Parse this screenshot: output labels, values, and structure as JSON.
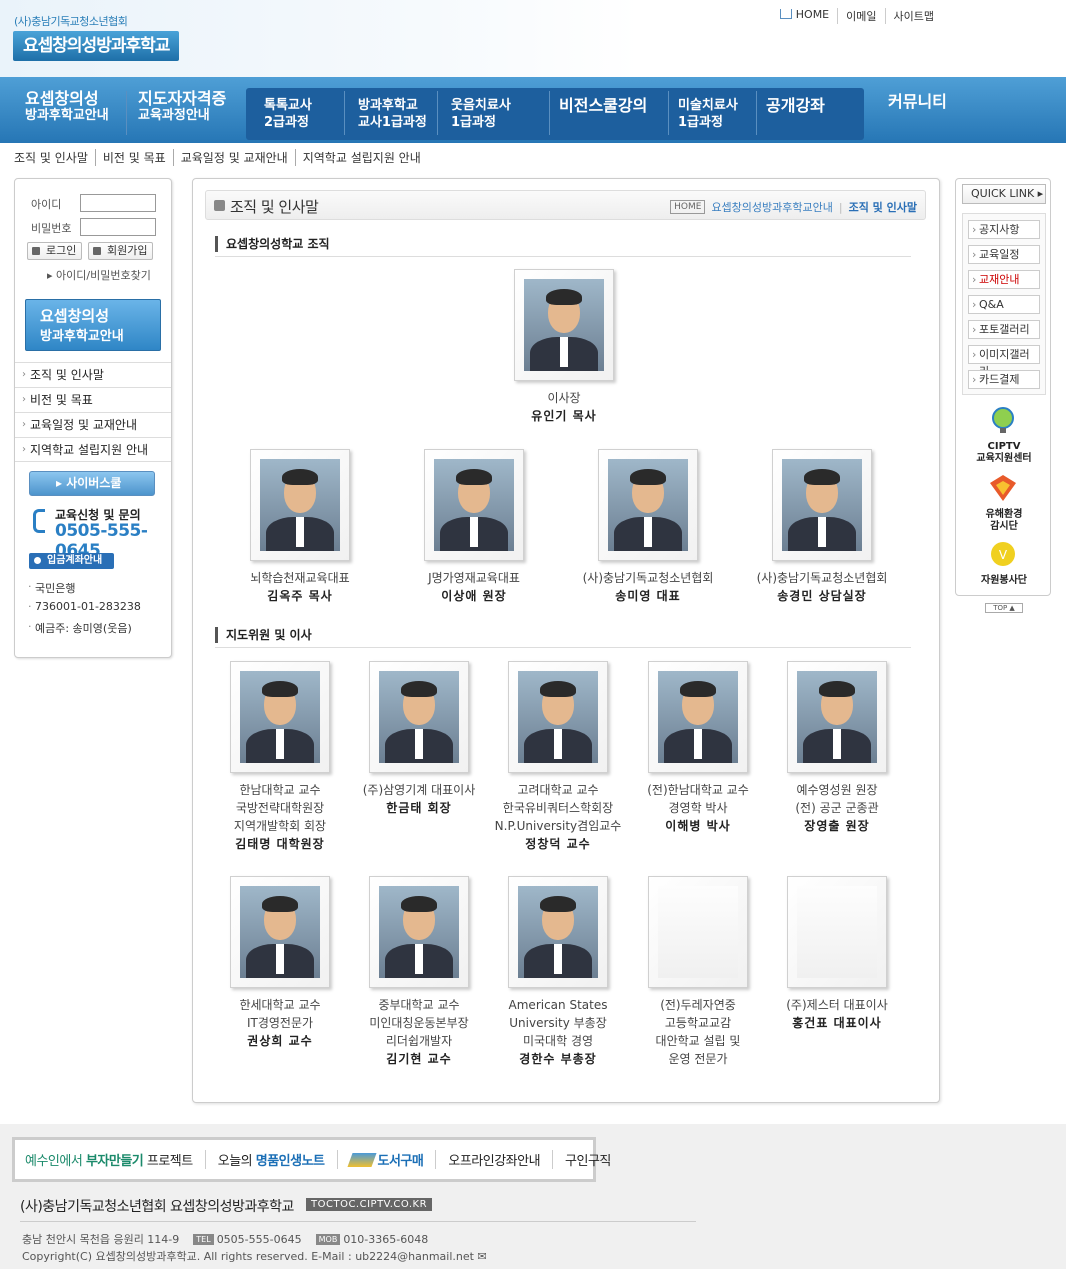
{
  "header": {
    "org_small": "(사)충남기독교청소년협회",
    "logo": "요셉창의성방과후학교",
    "links": [
      "HOME",
      "이메일",
      "사이트맵"
    ]
  },
  "nav": {
    "m1_title": "요셉창의성",
    "m1_sub": "방과후학교안내",
    "m2_title": "지도자자격증",
    "m2_sub": "교육과정안내",
    "s1_a": "톡톡교사",
    "s1_b": "2급과정",
    "s2_a": "방과후학교",
    "s2_b": "교사1급과정",
    "s3_a": "웃음치료사",
    "s3_b": "1급과정",
    "s4": "비전스쿨강의",
    "s5_a": "미술치료사",
    "s5_b": "1급과정",
    "s6": "공개강좌",
    "m3": "커뮤니티"
  },
  "crumbs": [
    "조직 및 인사말",
    "비전 및 목표",
    "교육일정 및 교재안내",
    "지역학교 설립지원 안내"
  ],
  "sidebar": {
    "id_label": "아이디",
    "pw_label": "비밀번호",
    "login": "로그인",
    "join": "회원가입",
    "find": "아이디/비밀번호찾기",
    "banner_title": "요셉창의성",
    "banner_sub": "방과후학교안내",
    "menu": [
      "조직 및 인사말",
      "비전 및 목표",
      "교육일정 및 교재안내",
      "지역학교 설립지원 안내"
    ],
    "cyber": "사이버스쿨",
    "apply_title": "교육신청 및 문의",
    "phone": "0505-555-0645",
    "deposit": "입금계좌안내",
    "bank": [
      "국민은행",
      "736001-01-283238",
      "예금주: 송미영(웃음)"
    ]
  },
  "content": {
    "title": "조직 및 인사말",
    "crumb_home": "HOME",
    "crumb_mid": "요셉창의성방과후학교안내",
    "crumb_cur": "조직 및 인사말",
    "sec1": "요셉창의성학교 조직",
    "sec2": "지도위원 및 이사",
    "chair": {
      "lines": [
        "이사장"
      ],
      "name": "유인기 목사"
    },
    "row2": [
      {
        "lines": [
          "뇌학습천재교육대표"
        ],
        "name": "김옥주 목사"
      },
      {
        "lines": [
          "J명가영재교육대표"
        ],
        "name": "이상애 원장"
      },
      {
        "lines": [
          "(사)충남기독교청소년협회"
        ],
        "name": "송미영 대표"
      },
      {
        "lines": [
          "(사)충남기독교청소년협회"
        ],
        "name": "송경민 상담실장"
      }
    ],
    "row3": [
      {
        "lines": [
          "한남대학교 교수",
          "국방전략대학원장",
          "지역개발학회 회장"
        ],
        "name": "김태명 대학원장"
      },
      {
        "lines": [
          "(주)삼영기계 대표이사"
        ],
        "name": "한금태 회장"
      },
      {
        "lines": [
          "고려대학교 교수",
          "한국유비쿼터스학회장",
          "N.P.University겸임교수"
        ],
        "name": "정창덕 교수"
      },
      {
        "lines": [
          "(전)한남대학교 교수",
          "경영학 박사"
        ],
        "name": "이해병 박사"
      },
      {
        "lines": [
          "예수영성원 원장",
          "(전) 공군 군종관"
        ],
        "name": "장영출 원장"
      }
    ],
    "row4": [
      {
        "lines": [
          "한세대학교 교수",
          "IT경영전문가"
        ],
        "name": "권상희 교수"
      },
      {
        "lines": [
          "중부대학교 교수",
          "미인대칭운동본부장",
          "리더쉽개발자"
        ],
        "name": "김기현 교수"
      },
      {
        "lines": [
          "American States",
          "University 부총장",
          "미국대학 경영"
        ],
        "name": "경한수 부총장"
      },
      {
        "lines": [
          "(전)두레자연중",
          "고등학교교감",
          "대안학교 설립 및",
          "운영 전문가"
        ],
        "name": ""
      },
      {
        "lines": [
          "(주)제스터 대표이사"
        ],
        "name": "홍건표 대표이사"
      }
    ]
  },
  "quick": {
    "head": "QUICK LINK",
    "items": [
      "공지사항",
      "교육일정",
      "교재안내",
      "Q&A",
      "포토갤러리",
      "이미지갤러리",
      "카드결제"
    ],
    "b1_a": "CIPTV",
    "b1_b": "교육지원센터",
    "b2_a": "유해환경",
    "b2_b": "감시단",
    "b3": "자원봉사단",
    "top": "TOP"
  },
  "footer": {
    "bar1_a": "예수인에서 ",
    "bar1_b": "부자만들기",
    "bar1_c": " 프로젝트",
    "bar2_a": "오늘의 ",
    "bar2_b": "명품인생노트",
    "bar3": "도서구매",
    "bar4": "오프라인강좌안내",
    "bar5": "구인구직",
    "org": "(사)충남기독교청소년협회 요셉창의성방과후학교",
    "url": "TOCTOC.CIPTV.CO.KR",
    "addr": "충남 천안시 목천읍 응원리 114-9",
    "tel_tag": "TEL",
    "tel": "0505-555-0645",
    "mob_tag": "MOB",
    "mob": "010-3365-6048",
    "copy": "Copyright(C) 요셉창의성방과후학교. All rights reserved.  E-Mail : ub2224@hanmail.net"
  }
}
